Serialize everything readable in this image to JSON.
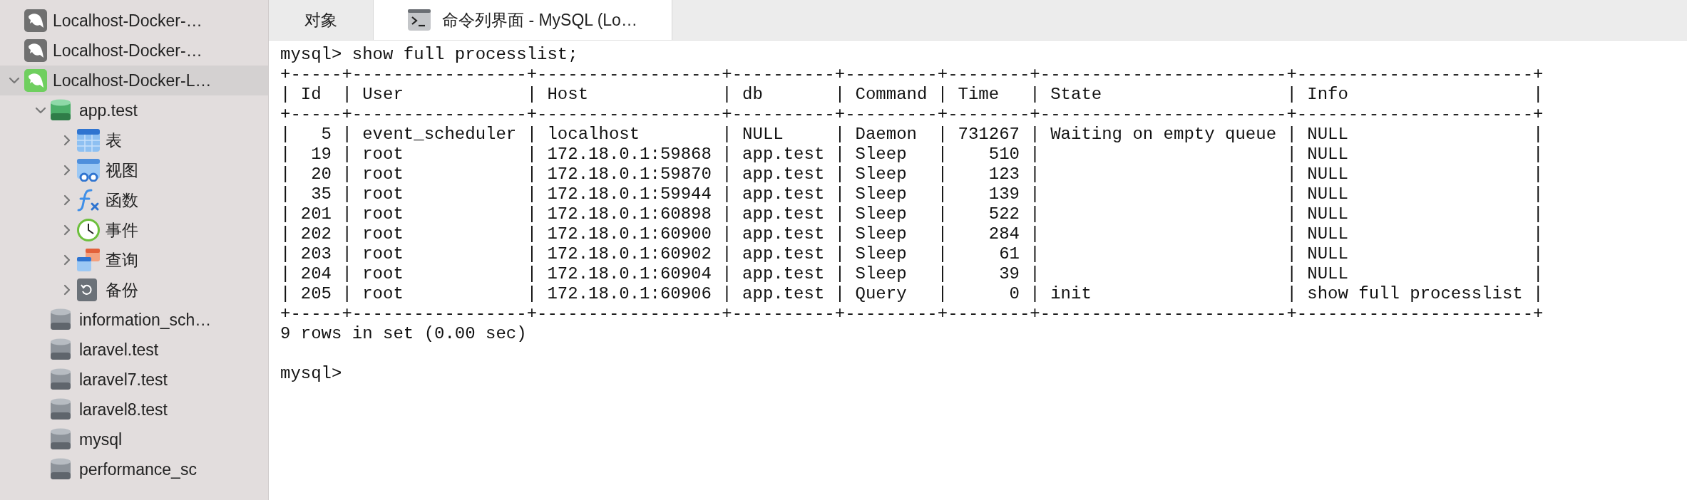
{
  "sidebar": {
    "items": [
      {
        "kind": "connection",
        "label": "Localhost-Docker-…",
        "connected": false,
        "expanded": false,
        "selected": false
      },
      {
        "kind": "connection",
        "label": "Localhost-Docker-…",
        "connected": false,
        "expanded": false,
        "selected": false
      },
      {
        "kind": "connection",
        "label": "Localhost-Docker-L…",
        "connected": true,
        "expanded": true,
        "selected": true,
        "children": [
          {
            "kind": "database",
            "label": "app.test",
            "open": true,
            "expanded": true,
            "selected": false,
            "children": [
              {
                "kind": "tables",
                "label": "表",
                "expanded": false,
                "selected": false
              },
              {
                "kind": "views",
                "label": "视图",
                "expanded": false,
                "selected": false
              },
              {
                "kind": "functions",
                "label": "函数",
                "expanded": false,
                "selected": false
              },
              {
                "kind": "events",
                "label": "事件",
                "expanded": false,
                "selected": false
              },
              {
                "kind": "queries",
                "label": "查询",
                "expanded": false,
                "selected": false
              },
              {
                "kind": "backups",
                "label": "备份",
                "expanded": false,
                "selected": false
              }
            ]
          },
          {
            "kind": "database",
            "label": "information_sch…",
            "open": false,
            "expanded": false,
            "selected": false
          },
          {
            "kind": "database",
            "label": "laravel.test",
            "open": false,
            "expanded": false,
            "selected": false
          },
          {
            "kind": "database",
            "label": "laravel7.test",
            "open": false,
            "expanded": false,
            "selected": false
          },
          {
            "kind": "database",
            "label": "laravel8.test",
            "open": false,
            "expanded": false,
            "selected": false
          },
          {
            "kind": "database",
            "label": "mysql",
            "open": false,
            "expanded": false,
            "selected": false
          },
          {
            "kind": "database",
            "label": "performance_sc",
            "open": false,
            "expanded": false,
            "selected": false
          }
        ]
      }
    ]
  },
  "tabs": [
    {
      "kind": "objects",
      "label": "对象",
      "selected": false
    },
    {
      "kind": "console",
      "label": "命令列界面 - MySQL (Lo…",
      "selected": true
    }
  ],
  "terminal": {
    "blocks": [
      {
        "lines": [
          "mysql> show full processlist;",
          "+-----+-----------------+------------------+----------+---------+--------+------------------------+-----------------------+",
          "| Id  | User            | Host             | db       | Command | Time   | State                  | Info                  |",
          "+-----+-----------------+------------------+----------+---------+--------+------------------------+-----------------------+",
          "|   5 | event_scheduler | localhost        | NULL     | Daemon  | 731267 | Waiting on empty queue | NULL                  |",
          "|  19 | root            | 172.18.0.1:59868 | app.test | Sleep   |    510 |                        | NULL                  |",
          "|  20 | root            | 172.18.0.1:59870 | app.test | Sleep   |    123 |                        | NULL                  |",
          "|  35 | root            | 172.18.0.1:59944 | app.test | Sleep   |    139 |                        | NULL                  |",
          "| 201 | root            | 172.18.0.1:60898 | app.test | Sleep   |    522 |                        | NULL                  |",
          "| 202 | root            | 172.18.0.1:60900 | app.test | Sleep   |    284 |                        | NULL                  |",
          "| 203 | root            | 172.18.0.1:60902 | app.test | Sleep   |     61 |                        | NULL                  |",
          "| 204 | root            | 172.18.0.1:60904 | app.test | Sleep   |     39 |                        | NULL                  |",
          "| 205 | root            | 172.18.0.1:60906 | app.test | Query   |      0 | init                   | show full processlist |",
          "+-----+-----------------+------------------+----------+---------+--------+------------------------+-----------------------+",
          "9 rows in set (0.00 sec)"
        ]
      },
      {
        "lines": [
          "mysql>"
        ]
      }
    ]
  }
}
